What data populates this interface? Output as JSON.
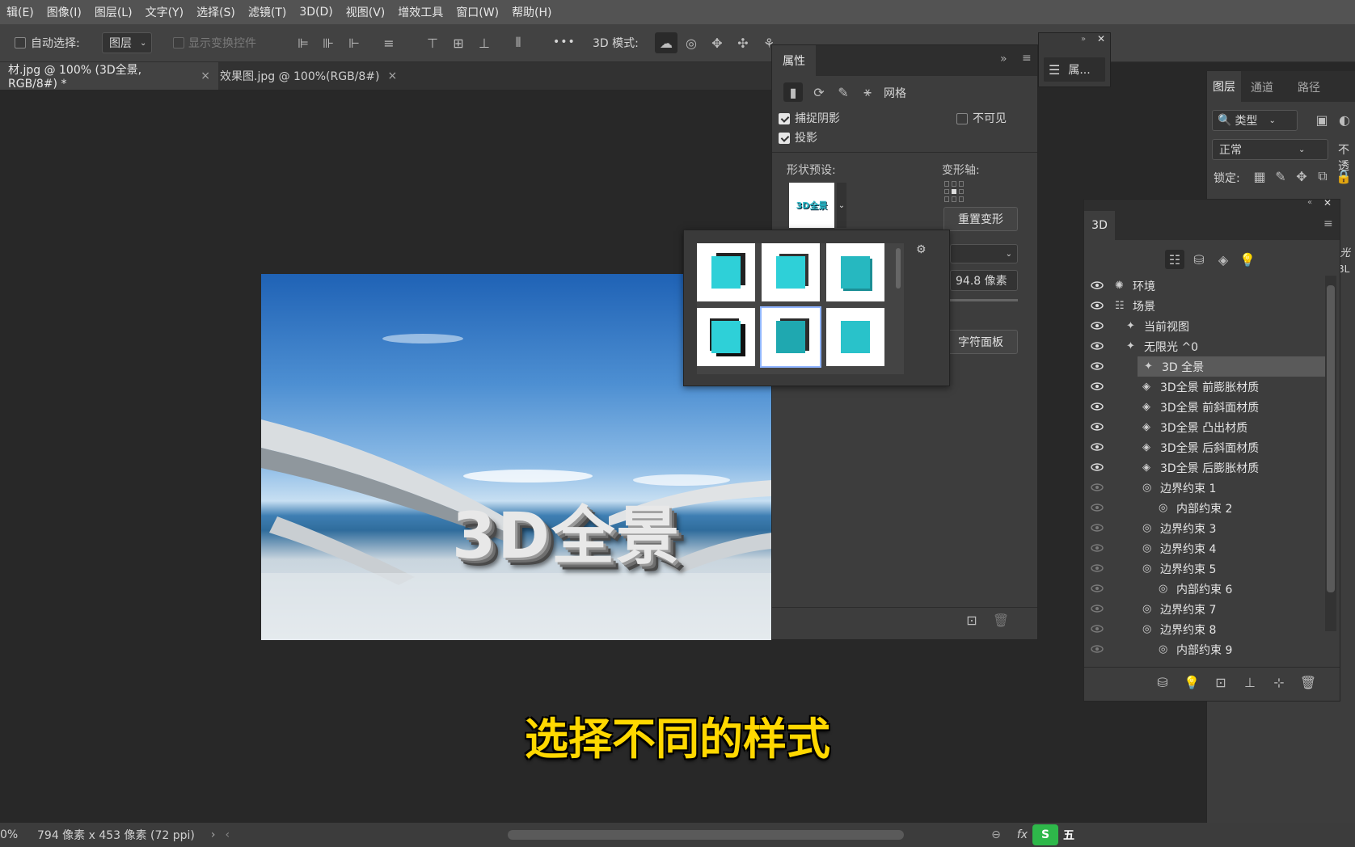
{
  "menu": [
    "辑(E)",
    "图像(I)",
    "图层(L)",
    "文字(Y)",
    "选择(S)",
    "滤镜(T)",
    "3D(D)",
    "视图(V)",
    "增效工具",
    "窗口(W)",
    "帮助(H)"
  ],
  "options": {
    "auto_select_label": "自动选择:",
    "auto_select_value": "图层",
    "show_transform_label": "显示变换控件",
    "mode_label": "3D 模式:",
    "more": "•••"
  },
  "tabs": [
    {
      "label": "材.jpg @ 100% (3D全景, RGB/8#) *",
      "active": true,
      "close": "×"
    },
    {
      "label": "效果图.jpg @ 100%(RGB/8#)",
      "active": false,
      "close": "×"
    }
  ],
  "canvas_text": "3D全景",
  "properties_panel": {
    "title": "属性",
    "mesh_tab": "网格",
    "catch_shadow": "捕捉阴影",
    "cast_shadow": "投影",
    "invisible": "不可见",
    "shape_preset_label": "形状预设:",
    "deform_axis_label": "变形轴:",
    "reset_deform": "重置变形",
    "preset_thumb_text": "3D全景",
    "depth_value": "94.8 像素",
    "char_panel": "字符面板"
  },
  "floating_props": {
    "label": "属..."
  },
  "layers_panel": {
    "tabs": [
      "图层",
      "通道",
      "路径"
    ],
    "filter_type": "类型",
    "blend_mode": "正常",
    "opacity_label": "不透",
    "lock_label": "锁定:",
    "side_text_1": "光",
    "side_text_2": "3L"
  },
  "panel_3d": {
    "title": "3D",
    "items": [
      {
        "label": "环境",
        "eye": true,
        "level": 0
      },
      {
        "label": "场景",
        "eye": true,
        "level": 0
      },
      {
        "label": "当前视图",
        "eye": true,
        "level": 1
      },
      {
        "label": "无限光 ^0",
        "eye": true,
        "level": 1
      },
      {
        "label": "3D 全景",
        "eye": true,
        "level": 1,
        "selected": true
      },
      {
        "label": "3D全景 前膨胀材质",
        "eye": true,
        "level": 2
      },
      {
        "label": "3D全景 前斜面材质",
        "eye": true,
        "level": 2
      },
      {
        "label": "3D全景 凸出材质",
        "eye": true,
        "level": 2
      },
      {
        "label": "3D全景 后斜面材质",
        "eye": true,
        "level": 2
      },
      {
        "label": "3D全景 后膨胀材质",
        "eye": true,
        "level": 2
      },
      {
        "label": "边界约束 1",
        "eye": false,
        "level": 2
      },
      {
        "label": "内部约束 2",
        "eye": false,
        "level": 3
      },
      {
        "label": "边界约束 3",
        "eye": false,
        "level": 2
      },
      {
        "label": "边界约束 4",
        "eye": false,
        "level": 2
      },
      {
        "label": "边界约束 5",
        "eye": false,
        "level": 2
      },
      {
        "label": "内部约束 6",
        "eye": false,
        "level": 3
      },
      {
        "label": "边界约束 7",
        "eye": false,
        "level": 2
      },
      {
        "label": "边界约束 8",
        "eye": false,
        "level": 2
      },
      {
        "label": "内部约束 9",
        "eye": false,
        "level": 3
      }
    ]
  },
  "subtitle": "选择不同的样式",
  "status": {
    "zoom": "0%",
    "size": "794 像素 x 453 像素 (72 ppi)",
    "fx": "fx",
    "brand": "五"
  },
  "colors": {
    "accent_cyan": "#2ed0d8",
    "subtitle_yellow": "#ffd800",
    "panel_bg": "#3d3d3d"
  }
}
